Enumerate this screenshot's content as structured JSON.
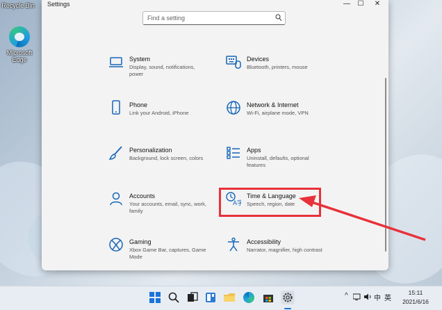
{
  "desktop": {
    "icons": [
      {
        "label": "Recycle Bin",
        "icon": "recycle-bin-icon"
      },
      {
        "label": "Microsoft Edge",
        "icon": "edge-icon"
      }
    ]
  },
  "window": {
    "title": "Settings",
    "controls": {
      "minimize": "—",
      "maximize": "☐",
      "close": "✕"
    }
  },
  "search": {
    "placeholder": "Find a setting",
    "icon": "search-icon"
  },
  "categories": [
    {
      "name": "System",
      "desc": "Display, sound, notifications, power",
      "icon": "laptop-icon"
    },
    {
      "name": "Devices",
      "desc": "Bluetooth, printers, mouse",
      "icon": "keyboard-icon"
    },
    {
      "name": "Phone",
      "desc": "Link your Android, iPhone",
      "icon": "phone-icon"
    },
    {
      "name": "Network & Internet",
      "desc": "Wi-Fi, airplane mode, VPN",
      "icon": "globe-icon"
    },
    {
      "name": "Personalization",
      "desc": "Background, lock screen, colors",
      "icon": "brush-icon"
    },
    {
      "name": "Apps",
      "desc": "Uninstall, defaults, optional features",
      "icon": "apps-list-icon"
    },
    {
      "name": "Accounts",
      "desc": "Your accounts, email, sync, work, family",
      "icon": "person-icon"
    },
    {
      "name": "Time & Language",
      "desc": "Speech, region, date",
      "icon": "time-language-icon"
    },
    {
      "name": "Gaming",
      "desc": "Xbox Game Bar, captures, Game Mode",
      "icon": "xbox-icon"
    },
    {
      "name": "Accessibility",
      "desc": "Narrator, magnifier, high contrast",
      "icon": "accessibility-icon"
    }
  ],
  "annotation": {
    "color": "#e8313a"
  },
  "accent": "#1565b8",
  "taskbar": {
    "apps": [
      "start-icon",
      "search-icon",
      "task-view-icon",
      "widgets-icon",
      "file-explorer-icon",
      "edge-icon",
      "store-icon",
      "settings-icon"
    ],
    "tray": {
      "chevron": "^",
      "ime": "中",
      "lang": "英"
    },
    "clock": {
      "time": "15:11",
      "date": "2021/6/16"
    }
  }
}
